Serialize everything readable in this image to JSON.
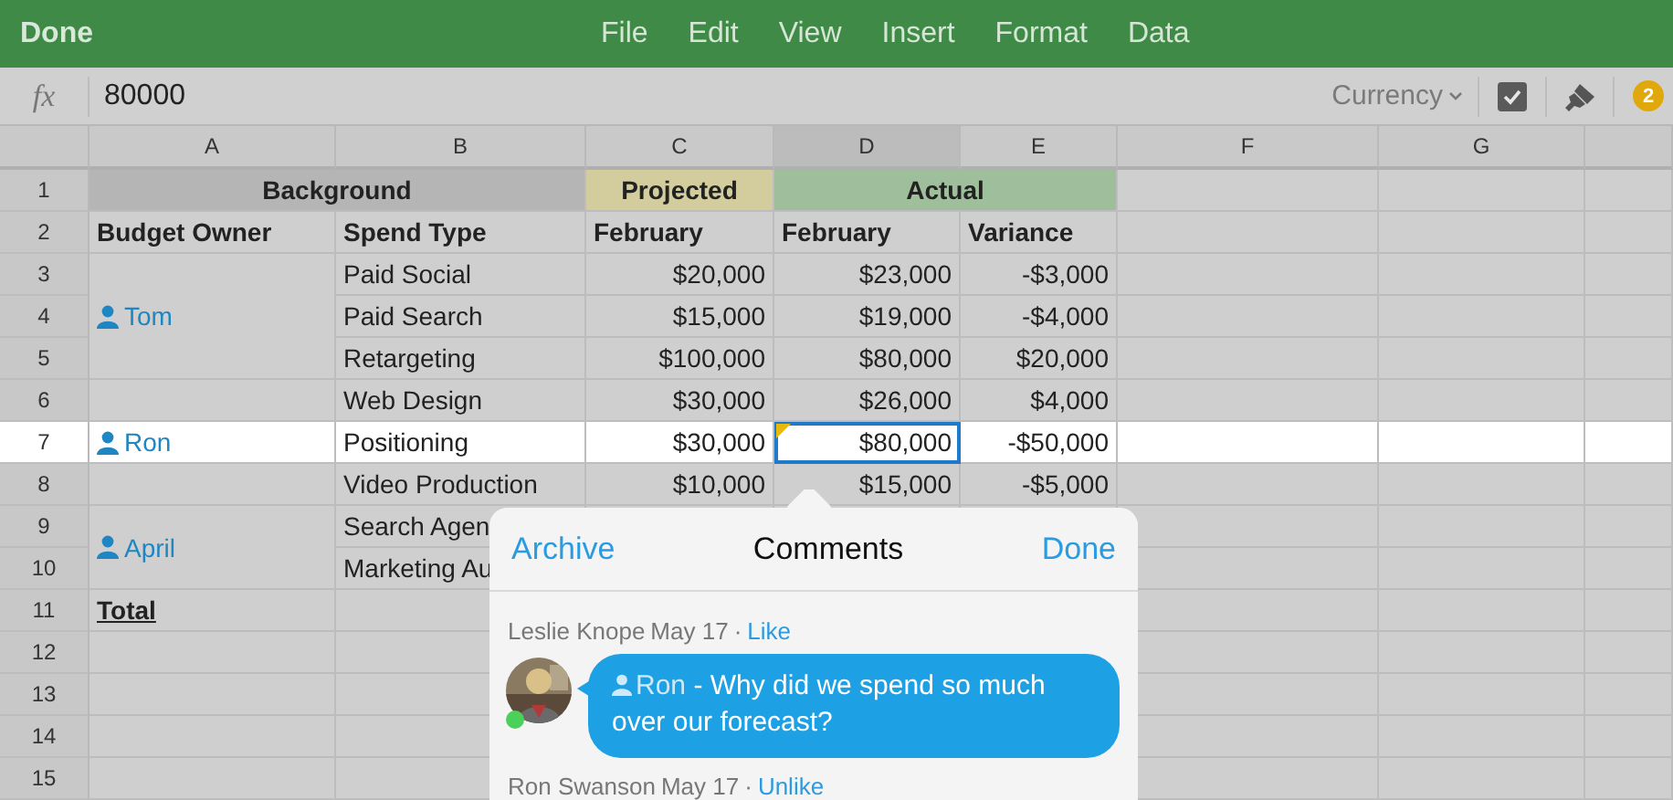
{
  "menubar": {
    "done": "Done",
    "items": [
      "File",
      "Edit",
      "View",
      "Insert",
      "Format",
      "Data"
    ]
  },
  "formula_bar": {
    "fx": "fx",
    "value": "80000",
    "format": "Currency",
    "comments_badge": "2"
  },
  "columns": [
    {
      "label": "A",
      "selected": false
    },
    {
      "label": "B",
      "selected": false
    },
    {
      "label": "C",
      "selected": false
    },
    {
      "label": "D",
      "selected": true
    },
    {
      "label": "E",
      "selected": false
    },
    {
      "label": "F",
      "selected": false
    },
    {
      "label": "G",
      "selected": false
    }
  ],
  "rows": [
    {
      "number": "1",
      "selected": false,
      "cells": [
        {
          "text": "Background",
          "kind": "header",
          "color": "#b5b5b5",
          "selected": false
        },
        {
          "merged_left": true
        },
        {
          "text": "Projected",
          "kind": "header",
          "color": "#d3cd9e",
          "selected": false
        },
        {
          "text": "Actual",
          "kind": "header",
          "color": "#9fbf9c",
          "selected": false
        },
        {
          "merged_left": true
        }
      ]
    },
    {
      "number": "2",
      "selected": false,
      "cells": [
        {
          "text": "Budget Owner",
          "kind": "bold",
          "selected": false
        },
        {
          "text": "Spend Type",
          "kind": "bold",
          "selected": false
        },
        {
          "text": "February",
          "kind": "bold",
          "selected": false
        },
        {
          "text": "February",
          "kind": "bold",
          "selected": false
        },
        {
          "text": "Variance",
          "kind": "bold",
          "selected": false
        }
      ]
    },
    {
      "number": "3",
      "selected": false,
      "cells": [
        {
          "text": "Tom",
          "kind": "person",
          "selected": false
        },
        {
          "text": "Paid Social",
          "kind": "text",
          "selected": false
        },
        {
          "text": "$20,000",
          "kind": "money",
          "selected": false
        },
        {
          "text": "$23,000",
          "kind": "money",
          "selected": false
        },
        {
          "text": "-$3,000",
          "kind": "money",
          "selected": false
        }
      ]
    },
    {
      "number": "4",
      "selected": false,
      "cells": [
        {
          "merged_up": true
        },
        {
          "text": "Paid Search",
          "kind": "text",
          "selected": false
        },
        {
          "text": "$15,000",
          "kind": "money",
          "selected": false
        },
        {
          "text": "$19,000",
          "kind": "money",
          "selected": false
        },
        {
          "text": "-$4,000",
          "kind": "money",
          "selected": false
        }
      ]
    },
    {
      "number": "5",
      "selected": false,
      "cells": [
        {
          "merged_up": true
        },
        {
          "text": "Retargeting",
          "kind": "text",
          "selected": false
        },
        {
          "text": "$100,000",
          "kind": "money",
          "selected": false
        },
        {
          "text": "$80,000",
          "kind": "money",
          "selected": false
        },
        {
          "text": "$20,000",
          "kind": "money",
          "selected": false
        }
      ]
    },
    {
      "number": "6",
      "selected": false,
      "cells": [
        {
          "selected": false
        },
        {
          "text": "Web Design",
          "kind": "text",
          "selected": false
        },
        {
          "text": "$30,000",
          "kind": "money",
          "selected": false
        },
        {
          "text": "$26,000",
          "kind": "money",
          "selected": false
        },
        {
          "text": "$4,000",
          "kind": "money",
          "selected": false
        }
      ]
    },
    {
      "number": "7",
      "selected": true,
      "cells": [
        {
          "text": "Ron",
          "kind": "person",
          "selected": false
        },
        {
          "text": "Positioning",
          "kind": "text",
          "selected": false
        },
        {
          "text": "$30,000",
          "kind": "money",
          "selected": false
        },
        {
          "text": "$80,000",
          "kind": "money",
          "selected": true,
          "has_comment": true
        },
        {
          "text": "-$50,000",
          "kind": "money",
          "selected": false
        }
      ]
    },
    {
      "number": "8",
      "selected": false,
      "cells": [
        {
          "selected": false
        },
        {
          "text": "Video Production",
          "kind": "text",
          "selected": false
        },
        {
          "text": "$10,000",
          "kind": "money",
          "selected": false
        },
        {
          "text": "$15,000",
          "kind": "money",
          "selected": false
        },
        {
          "text": "-$5,000",
          "kind": "money",
          "selected": false
        }
      ]
    },
    {
      "number": "9",
      "selected": false,
      "cells": [
        {
          "text": "April",
          "kind": "person",
          "selected": false
        },
        {
          "text": "Search Agen",
          "kind": "text",
          "selected": false
        }
      ]
    },
    {
      "number": "10",
      "selected": false,
      "cells": [
        {
          "merged_up": true
        },
        {
          "text": "Marketing Au",
          "kind": "text",
          "selected": false
        }
      ]
    },
    {
      "number": "11",
      "selected": false,
      "cells": [
        {
          "text": "Total",
          "kind": "total",
          "selected": false
        },
        {
          "selected": false
        }
      ]
    },
    {
      "number": "12",
      "selected": false,
      "cells": [
        {
          "selected": false
        },
        {
          "selected": false
        }
      ]
    },
    {
      "number": "13",
      "selected": false,
      "cells": [
        {
          "selected": false
        },
        {
          "selected": false
        }
      ]
    },
    {
      "number": "14",
      "selected": false,
      "cells": [
        {
          "selected": false
        },
        {
          "selected": false
        }
      ]
    },
    {
      "number": "15",
      "selected": false,
      "cells": [
        {
          "selected": false
        },
        {
          "selected": false
        }
      ]
    }
  ],
  "comments_popover": {
    "left_action": "Archive",
    "title": "Comments",
    "right_action": "Done",
    "comments": [
      {
        "author": "Leslie Knope",
        "date": "May 17",
        "separator": "·",
        "action": "Like",
        "online": true,
        "mention": "Ron",
        "message": " - Why did we spend so much over our forecast?"
      },
      {
        "author": "Ron Swanson",
        "date": "May 17",
        "separator": "·",
        "action": "Unlike"
      }
    ]
  }
}
